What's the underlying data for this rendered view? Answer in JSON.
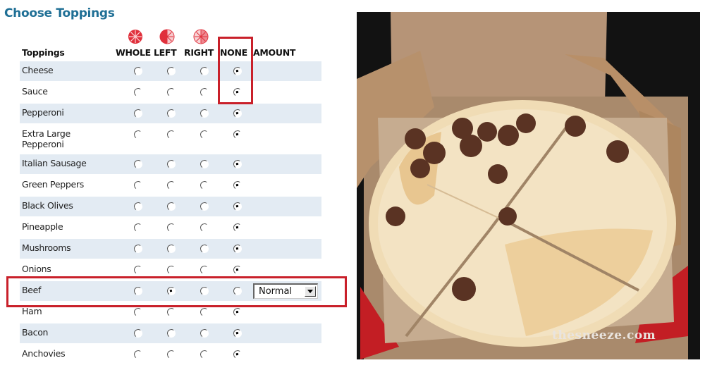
{
  "title": "Choose Toppings",
  "columns": {
    "toppings": "Toppings",
    "whole": "WHOLE",
    "left": "LEFT",
    "right": "RIGHT",
    "none": "NONE",
    "amount": "AMOUNT"
  },
  "icons": {
    "whole": "pizza-whole-icon",
    "left": "pizza-left-half-icon",
    "right": "pizza-right-half-icon"
  },
  "toppings": [
    {
      "name": "Cheese",
      "selected": "none"
    },
    {
      "name": "Sauce",
      "selected": "none"
    },
    {
      "name": "Pepperoni",
      "selected": "none"
    },
    {
      "name": "Extra Large Pepperoni",
      "selected": "none"
    },
    {
      "name": "Italian Sausage",
      "selected": "none"
    },
    {
      "name": "Green Peppers",
      "selected": "none"
    },
    {
      "name": "Black Olives",
      "selected": "none"
    },
    {
      "name": "Pineapple",
      "selected": "none"
    },
    {
      "name": "Mushrooms",
      "selected": "none"
    },
    {
      "name": "Onions",
      "selected": "none"
    },
    {
      "name": "Beef",
      "selected": "left",
      "amount": "Normal"
    },
    {
      "name": "Ham",
      "selected": "none"
    },
    {
      "name": "Bacon",
      "selected": "none"
    },
    {
      "name": "Anchovies",
      "selected": "none"
    }
  ],
  "annotations": {
    "color": "#c9202a",
    "highlight_none_column": "Cheese & Sauce set to NONE",
    "highlight_row": "Beef"
  },
  "photo": {
    "description": "Pizza with no cheese or sauce and beef only on left half, in an open cardboard box",
    "watermark": "thesneeze.com"
  },
  "colors": {
    "title": "#1f6f95",
    "row_shade": "#e3ebf3",
    "icon_red": "#e0303c"
  }
}
